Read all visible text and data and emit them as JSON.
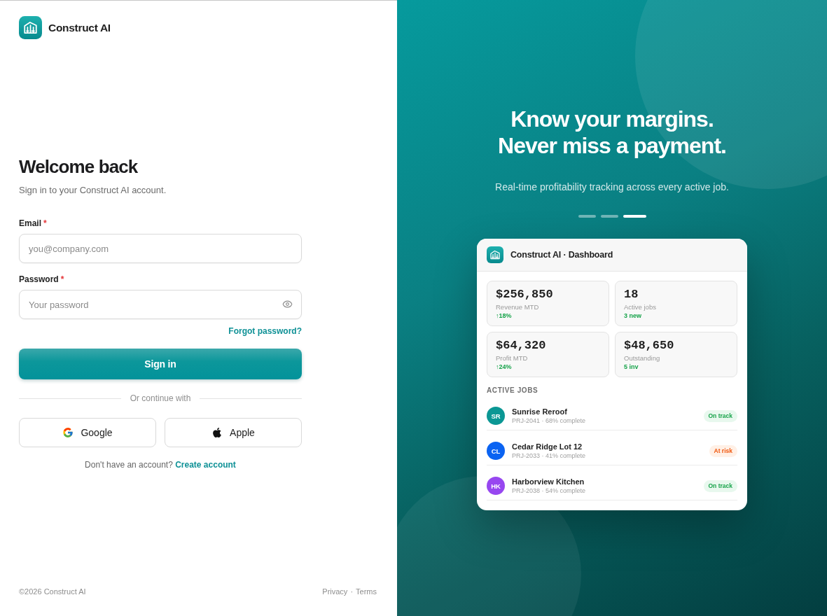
{
  "brand": {
    "name": "Construct AI"
  },
  "sign_in_form": {
    "title": "Welcome back",
    "subtitle": "Sign in to your Construct AI account.",
    "fields": [
      {
        "kind": "email",
        "label": "Email",
        "required_mark": "*",
        "placeholder": "you@company.com"
      },
      {
        "kind": "password",
        "label": "Password",
        "required_mark": "*",
        "placeholder": "Your password"
      }
    ],
    "forgot_password_link": "Forgot password?",
    "submit_button": "Sign in",
    "divider_label": "Or continue with",
    "social_buttons": [
      {
        "kind": "google",
        "label": "Google"
      },
      {
        "kind": "apple",
        "label": "Apple"
      }
    ],
    "signup_prompt": {
      "text": "Don't have an account?",
      "link": "Create account"
    }
  },
  "footer": {
    "copyright": "©2026 Construct AI",
    "links": [
      "Privacy",
      "Terms"
    ],
    "separator": "·"
  },
  "promo": {
    "headline_lines": [
      "Know your margins.",
      "Never miss a payment."
    ],
    "subtitle": "Real-time profitability tracking across every active job.",
    "carousel_dots": [
      {
        "selected": false
      },
      {
        "selected": false
      },
      {
        "selected": true
      }
    ],
    "dashboard_preview": {
      "title": "Construct AI · Dashboard",
      "stats": [
        {
          "value": "$256,850",
          "label": "Revenue MTD",
          "change": "↑18%"
        },
        {
          "value": "18",
          "label": "Active jobs",
          "change": "3 new"
        },
        {
          "value": "$64,320",
          "label": "Profit MTD",
          "change": "↑24%"
        },
        {
          "value": "$48,650",
          "label": "Outstanding",
          "change": "5 inv"
        }
      ],
      "section_title": "ACTIVE JOBS",
      "jobs": [
        {
          "initials": "SR",
          "color": "#0b9794",
          "name": "Sunrise Reroof",
          "detail": "PRJ-2041 · 68% complete",
          "status": {
            "kind": "on_track",
            "label": "On track"
          }
        },
        {
          "initials": "CL",
          "color": "#0a63f2",
          "name": "Cedar Ridge Lot 12",
          "detail": "PRJ-2033 · 41% complete",
          "status": {
            "kind": "at_risk",
            "label": "At risk"
          }
        },
        {
          "initials": "HK",
          "color": "#9747f0",
          "name": "Harborview Kitchen",
          "detail": "PRJ-2038 · 54% complete",
          "status": {
            "kind": "on_track",
            "label": "On track"
          }
        }
      ]
    }
  }
}
